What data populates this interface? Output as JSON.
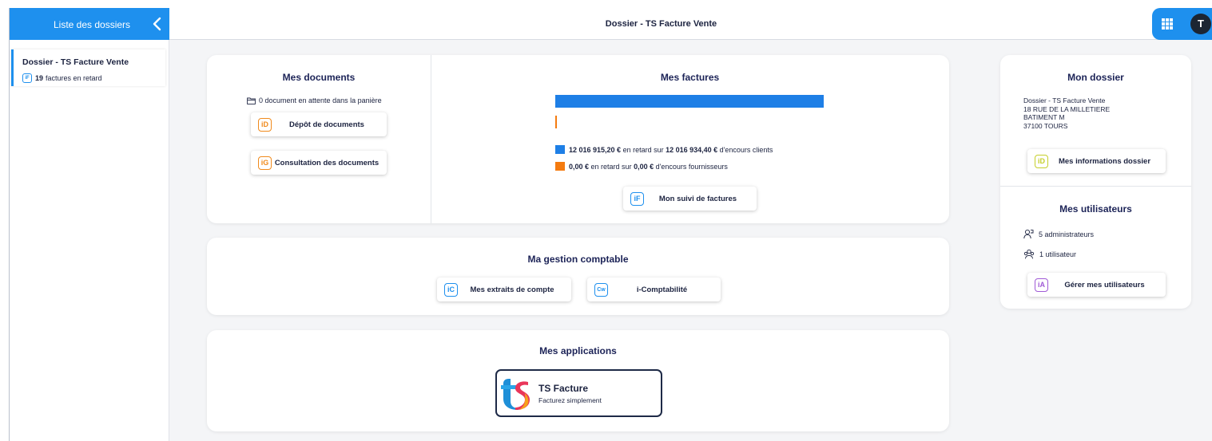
{
  "topbar": {
    "sidebar_title": "Liste des dossiers",
    "page_title": "Dossier - TS Facture Vente",
    "avatar_initial": "T"
  },
  "sidebar": {
    "folder": {
      "name": "Dossier - TS Facture Vente",
      "badge": "iF",
      "late_count": "19",
      "late_label": "factures en retard"
    }
  },
  "documents": {
    "title": "Mes documents",
    "pending": "0 document en attente dans la panière",
    "depot": {
      "badge": "iD",
      "label": "Dépôt de documents"
    },
    "consultation": {
      "badge": "iG",
      "label": "Consultation des documents"
    }
  },
  "factures": {
    "title": "Mes factures",
    "clients_late": "12 016 915,20 €",
    "mid1": " en retard sur ",
    "clients_total": "12 016 934,40 €",
    "clients_suffix": " d'encours clients",
    "fourn_late": "0,00 €",
    "mid2": " en retard sur ",
    "fourn_total": "0,00 €",
    "fourn_suffix": " d'encours fournisseurs",
    "suivi": {
      "badge": "iF",
      "label": "Mon suivi de factures"
    },
    "bars": {
      "clients_fraction": 1.0,
      "fournisseurs_fraction": 0.0
    },
    "colors": {
      "clients": "#1e7fe6",
      "fournisseurs": "#f47b10"
    }
  },
  "gestion": {
    "title": "Ma gestion comptable",
    "extraits": {
      "badge": "iC",
      "label": "Mes extraits de compte"
    },
    "comptabilite": {
      "badge": "Cw",
      "label": "i-Comptabilité"
    }
  },
  "applications": {
    "title": "Mes applications",
    "app": {
      "name": "TS Facture",
      "tagline": "Facturez simplement"
    }
  },
  "dossier": {
    "title": "Mon dossier",
    "address": [
      "Dossier - TS Facture Vente",
      "18 RUE DE LA MILLETIERE",
      "BATIMENT M",
      "37100 TOURS"
    ],
    "infos": {
      "badge": "iD",
      "label": "Mes informations dossier"
    }
  },
  "utilisateurs": {
    "title": "Mes utilisateurs",
    "admins": "5 administrateurs",
    "users": "1 utilisateur",
    "gerer": {
      "badge": "iA",
      "label": "Gérer mes utilisateurs"
    }
  }
}
